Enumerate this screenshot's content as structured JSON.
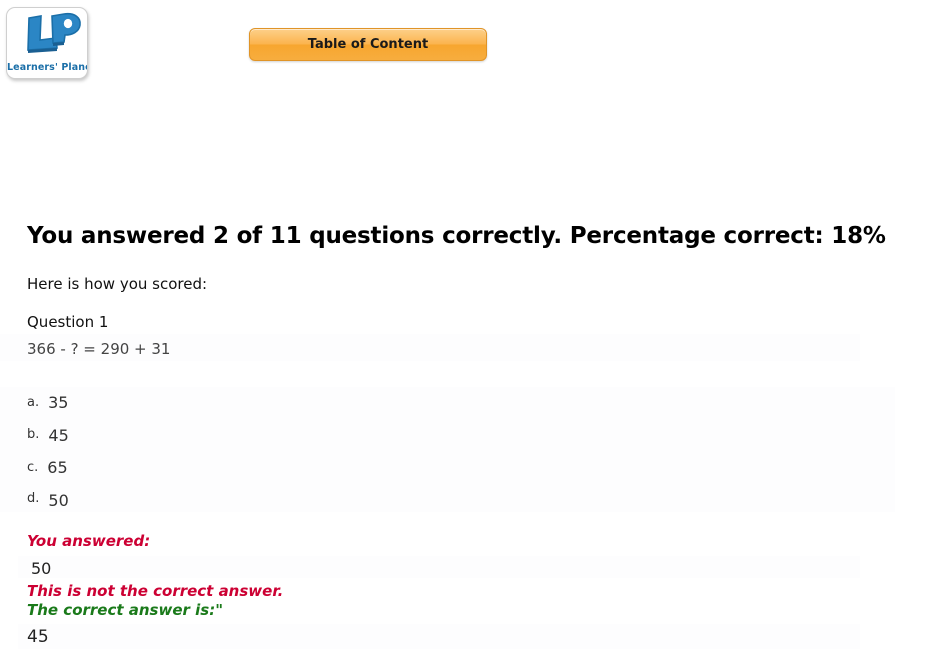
{
  "header": {
    "logo": {
      "mark_text": "LP",
      "caption": "Learners' Planet",
      "brand_color": "#1b6fa8"
    },
    "toc_button_label": "Table of Content",
    "toc_button_color": "#f7a62f"
  },
  "result": {
    "heading": "You answered 2 of 11 questions correctly. Percentage correct: 18%",
    "correct_count": 2,
    "total_count": 11,
    "percentage": "18%",
    "scored_intro": "Here is how you scored:"
  },
  "question": {
    "label": "Question 1",
    "text": "366 - ? = 290 + 31",
    "options": [
      {
        "letter": "a.",
        "value": "35"
      },
      {
        "letter": "b.",
        "value": "45"
      },
      {
        "letter": "c.",
        "value": "65"
      },
      {
        "letter": "d.",
        "value": "50"
      }
    ]
  },
  "feedback": {
    "you_answered_label": "You answered:",
    "user_answer": "50",
    "incorrect_message": "This is not the correct answer.",
    "correct_answer_label": "The correct answer is:\"",
    "correct_answer": "45",
    "incorrect_color": "#cc0033",
    "correct_color": "#1a7a1a"
  }
}
